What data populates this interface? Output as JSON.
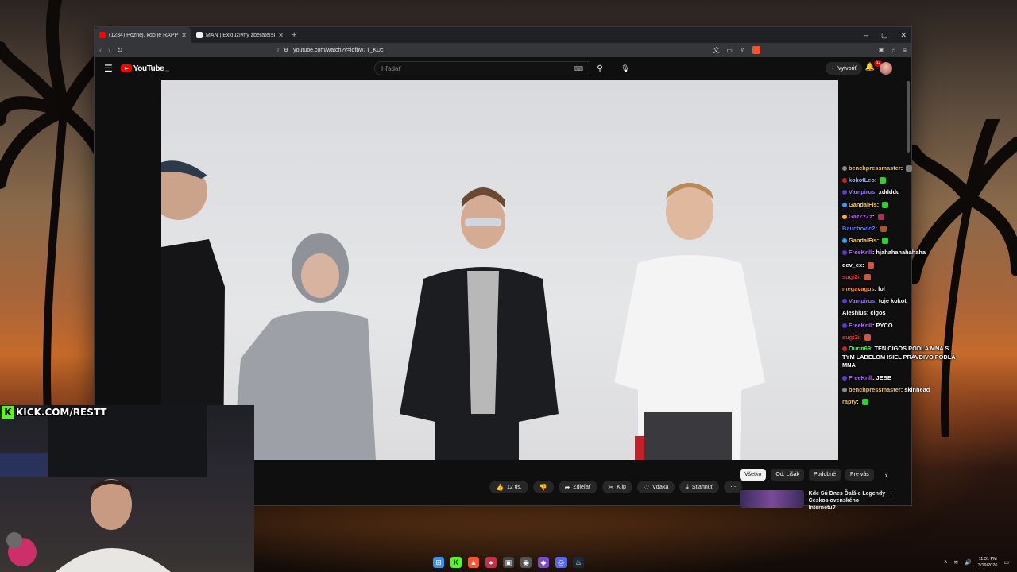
{
  "browser": {
    "tabs": [
      {
        "title": "(1234) Poznej, kdo je RAPPER",
        "active": true,
        "favicon_color": "#ff0000"
      },
      {
        "title": "MAN | Exkluzívny zberateľský produkt",
        "active": false,
        "favicon_color": "#f1f1f1"
      }
    ],
    "new_tab": "+",
    "window_controls": {
      "minimize": "–",
      "maximize": "▢",
      "close": "✕"
    },
    "url": "youtube.com/watch?v=lqfbw7T_KUc"
  },
  "youtube": {
    "logo_text": "YouTube",
    "country_code": "SK",
    "search_placeholder": "Hľadať",
    "create_label": "Vytvoriť",
    "notifications_count": "9+",
    "actions": {
      "likes": "12 tis.",
      "share": "Zdieľať",
      "clip": "Klip",
      "thanks": "Vďaka",
      "download": "Stiahnuť",
      "more": "⋯"
    },
    "chips": [
      "Všetko",
      "Od: Lišák",
      "Podobné",
      "Pre vás"
    ],
    "recommendation_title": "Kde Sú Dnes Ďalšie Legendy Československého Internetu?"
  },
  "chat": [
    {
      "user": "benchpressmaster",
      "color": "#e8c060",
      "msg": "",
      "badge": "#888888",
      "emote": "#7a7a7a"
    },
    {
      "user": "kokotLeo",
      "color": "#9ab4ff",
      "msg": "",
      "badge": "#cc2222",
      "emote": "#33cc33"
    },
    {
      "user": "Vampirus",
      "color": "#9a7aff",
      "msg": "xddddd",
      "badge": "#5a3ad0",
      "emote": ""
    },
    {
      "user": "GandalFis",
      "color": "#ffd060",
      "msg": "",
      "badge": "#30a0ff",
      "emote": "#33cc33"
    },
    {
      "user": "GazZzZz",
      "color": "#c060ff",
      "msg": "",
      "badge": "#ffaa33",
      "emote": "#aa3355"
    },
    {
      "user": "Bauchovic2",
      "color": "#6080ff",
      "msg": "",
      "badge": "",
      "emote": "#aa5533"
    },
    {
      "user": "GandalFis",
      "color": "#ffd060",
      "msg": "",
      "badge": "#30a0ff",
      "emote": "#33cc33"
    },
    {
      "user": "FreeKrill",
      "color": "#b070ff",
      "msg": "hjahahahahahaha",
      "badge": "#5a3ad0",
      "emote": ""
    },
    {
      "user": "dev_ex",
      "color": "#ffffff",
      "msg": "",
      "badge": "",
      "emote": "#cc5544"
    },
    {
      "user": "sugi2i",
      "color": "#ff3030",
      "msg": "",
      "badge": "",
      "emote": "#cc5544"
    },
    {
      "user": "megavagus",
      "color": "#ff9040",
      "msg": "lol",
      "badge": "",
      "emote": ""
    },
    {
      "user": "Vampirus",
      "color": "#9a7aff",
      "msg": "toje kokot",
      "badge": "#5a3ad0",
      "emote": ""
    },
    {
      "user": "Aleshius",
      "color": "#ffffff",
      "msg": "cigos",
      "badge": "",
      "emote": ""
    },
    {
      "user": "FreeKrill",
      "color": "#b070ff",
      "msg": "PYCO",
      "badge": "#5a3ad0",
      "emote": ""
    },
    {
      "user": "sugi2i",
      "color": "#ff3030",
      "msg": "",
      "badge": "",
      "emote": "#cc5544"
    },
    {
      "user": "Ourin69",
      "color": "#60ff60",
      "msg": "TEN CIGOS PODLA MNA S TYM LABELOM ISIEL PRAVDIVO PODLA MNA",
      "badge": "#cc2222",
      "emote": "",
      "wrap": true
    },
    {
      "user": "FreeKrill",
      "color": "#b070ff",
      "msg": "JEBE",
      "badge": "#5a3ad0",
      "emote": ""
    },
    {
      "user": "benchpressmaster",
      "color": "#e8c060",
      "msg": "skinhead",
      "badge": "#888888",
      "emote": ""
    },
    {
      "user": "rapty",
      "color": "#e8c060",
      "msg": "",
      "badge": "",
      "emote": "#33cc33"
    }
  ],
  "overlay": {
    "kick_handle": "KICK.COM/RESTT"
  },
  "taskbar": {
    "time": "11:31 PM",
    "date": "3/19/2026"
  }
}
